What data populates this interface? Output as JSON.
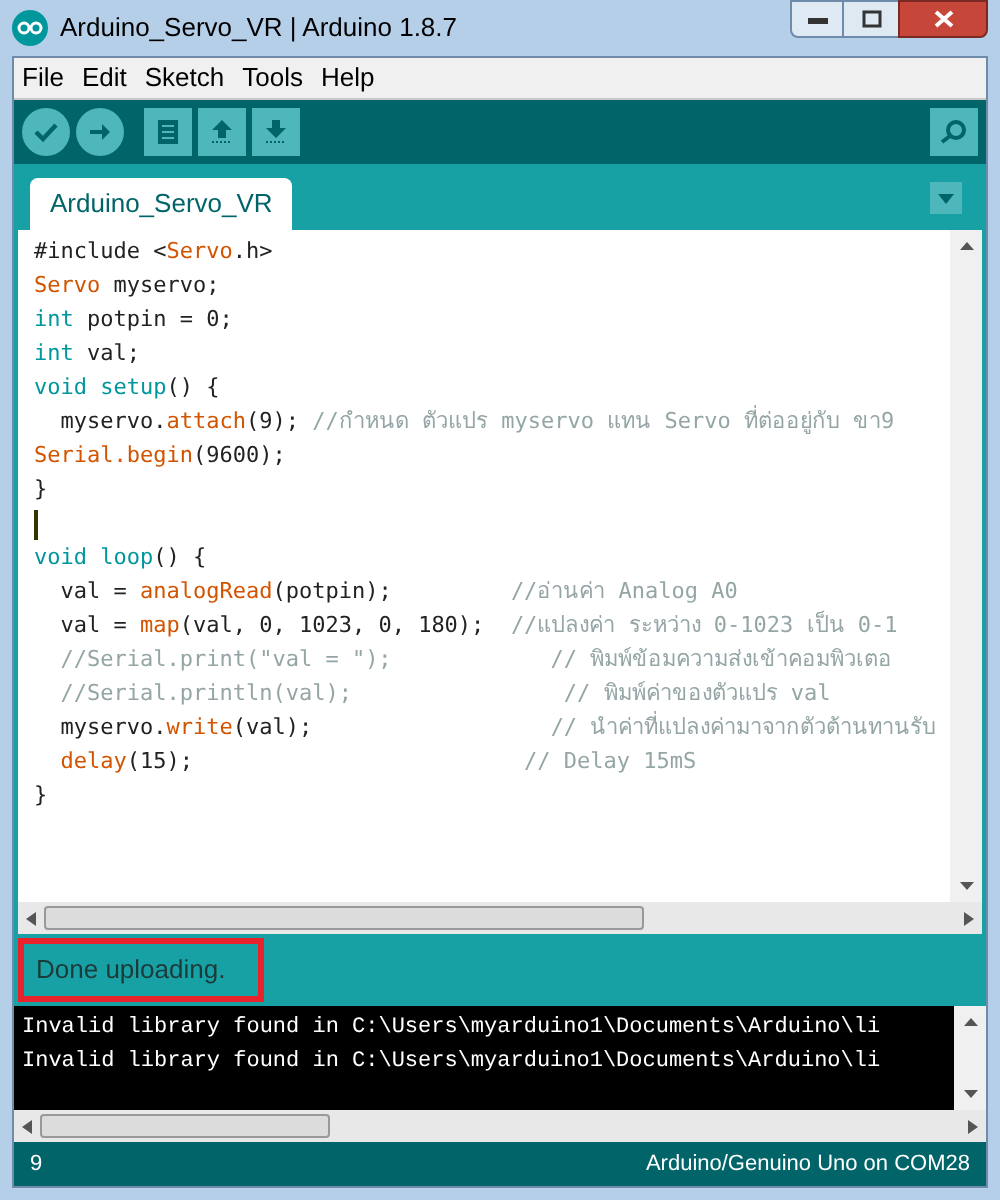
{
  "window": {
    "title": "Arduino_Servo_VR | Arduino 1.8.7"
  },
  "menu": [
    "File",
    "Edit",
    "Sketch",
    "Tools",
    "Help"
  ],
  "tabs": [
    {
      "label": "Arduino_Servo_VR",
      "selected": true
    }
  ],
  "editor": {
    "lines": [
      {
        "segments": [
          {
            "text": "#include <",
            "kind": "plain"
          },
          {
            "text": "Servo",
            "kind": "func"
          },
          {
            "text": ".h>",
            "kind": "plain"
          }
        ]
      },
      {
        "segments": [
          {
            "text": "Servo",
            "kind": "func"
          },
          {
            "text": " myservo;",
            "kind": "plain"
          }
        ]
      },
      {
        "segments": [
          {
            "text": "int",
            "kind": "type"
          },
          {
            "text": " potpin = 0;",
            "kind": "plain"
          }
        ]
      },
      {
        "segments": [
          {
            "text": "int",
            "kind": "type"
          },
          {
            "text": " val;",
            "kind": "plain"
          }
        ]
      },
      {
        "segments": [
          {
            "text": "void setup",
            "kind": "type"
          },
          {
            "text": "() {",
            "kind": "plain"
          }
        ]
      },
      {
        "segments": [
          {
            "text": "  myservo.",
            "kind": "plain"
          },
          {
            "text": "attach",
            "kind": "func"
          },
          {
            "text": "(9); ",
            "kind": "plain"
          },
          {
            "text": "//กำหนด ตัวแปร myservo แทน Servo ที่ต่ออยู่กับ ขา9",
            "kind": "comment"
          }
        ]
      },
      {
        "segments": [
          {
            "text": "Serial.begin",
            "kind": "func"
          },
          {
            "text": "(9600);",
            "kind": "plain"
          }
        ]
      },
      {
        "segments": [
          {
            "text": "}",
            "kind": "plain"
          }
        ]
      },
      {
        "caret": true
      },
      {
        "segments": [
          {
            "text": "void loop",
            "kind": "type"
          },
          {
            "text": "() {",
            "kind": "plain"
          }
        ]
      },
      {
        "segments": [
          {
            "text": "  val = ",
            "kind": "plain"
          },
          {
            "text": "analogRead",
            "kind": "func"
          },
          {
            "text": "(potpin);         ",
            "kind": "plain"
          },
          {
            "text": "//อ่านค่า Analog A0",
            "kind": "comment"
          }
        ]
      },
      {
        "segments": [
          {
            "text": "  val = ",
            "kind": "plain"
          },
          {
            "text": "map",
            "kind": "func"
          },
          {
            "text": "(val, 0, 1023, 0, 180);  ",
            "kind": "plain"
          },
          {
            "text": "//แปลงค่า ระหว่าง 0-1023 เป็น 0-1",
            "kind": "comment"
          }
        ]
      },
      {
        "segments": [
          {
            "text": "  //Serial.print(\"val = \");            // พิมพ์ข้อมความส่งเข้าคอมพิวเตอ",
            "kind": "comment"
          }
        ]
      },
      {
        "segments": [
          {
            "text": "  //Serial.println(val);                // พิมพ์ค่าของตัวแปร val",
            "kind": "comment"
          }
        ]
      },
      {
        "segments": [
          {
            "text": "  myservo.",
            "kind": "plain"
          },
          {
            "text": "write",
            "kind": "func"
          },
          {
            "text": "(val);                  ",
            "kind": "plain"
          },
          {
            "text": "// นำค่าที่แปลงค่ามาจากตัวต้านทานรับ",
            "kind": "comment"
          }
        ]
      },
      {
        "segments": [
          {
            "text": "  delay",
            "kind": "func"
          },
          {
            "text": "(15);                         ",
            "kind": "plain"
          },
          {
            "text": "// Delay 15mS",
            "kind": "comment"
          }
        ]
      },
      {
        "segments": [
          {
            "text": "}",
            "kind": "plain"
          }
        ]
      }
    ]
  },
  "status": {
    "message": "Done uploading.",
    "highlighted": true
  },
  "console": [
    "Invalid library found in C:\\Users\\myarduino1\\Documents\\Arduino\\li",
    "Invalid library found in C:\\Users\\myarduino1\\Documents\\Arduino\\li"
  ],
  "footer": {
    "line": "9",
    "board": "Arduino/Genuino Uno on COM28"
  }
}
